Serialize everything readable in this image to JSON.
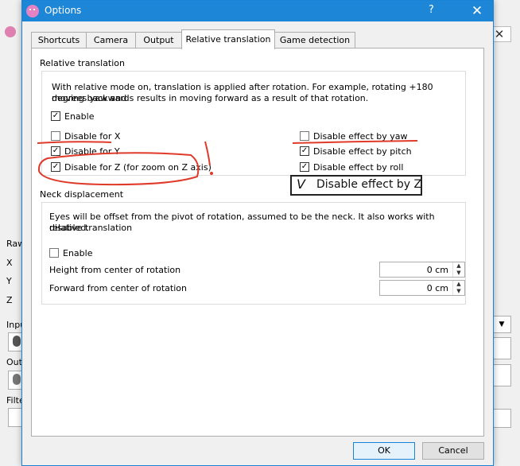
{
  "dialog": {
    "title": "Options",
    "help_label": "?",
    "close_label": "✕"
  },
  "tabs": [
    {
      "label": "Shortcuts"
    },
    {
      "label": "Camera"
    },
    {
      "label": "Output"
    },
    {
      "label": "Relative translation",
      "active": true
    },
    {
      "label": "Game detection"
    }
  ],
  "relative_translation": {
    "section_title": "Relative translation",
    "description_line1": "With relative mode on, translation is applied after rotation. For example, rotating +180 degrees yaw and",
    "description_line2": "moving backwards results in moving forward as a result of that rotation.",
    "enable": {
      "label": "Enable",
      "checked": true
    },
    "disable_x": {
      "label": "Disable for X",
      "checked": false
    },
    "disable_y": {
      "label": "Disable for Y",
      "checked": true
    },
    "disable_z": {
      "label": "Disable for Z (for zoom on Z axis)",
      "checked": true
    },
    "disable_yaw": {
      "label": "Disable effect by yaw",
      "checked": false
    },
    "disable_pitch": {
      "label": "Disable effect by pitch",
      "checked": true
    },
    "disable_roll": {
      "label": "Disable effect by roll",
      "checked": true
    }
  },
  "neck_displacement": {
    "section_title": "Neck displacement",
    "description_line1": "Eyes will be offset from the pivot of rotation, assumed to be the neck. It also works with relative translation",
    "description_line2": "disabled.",
    "enable": {
      "label": "Enable",
      "checked": false
    },
    "height": {
      "label": "Height from center of rotation",
      "value": "0 cm"
    },
    "forward": {
      "label": "Forward from center of rotation",
      "value": "0 cm"
    }
  },
  "buttons": {
    "ok": "OK",
    "cancel": "Cancel"
  },
  "annotation": {
    "text": "Disable effect by Z",
    "mark": "V",
    "exclaim": "!"
  },
  "background": {
    "raw_label": "Raw",
    "x_label": "X",
    "y_label": "Y",
    "z_label": "Z",
    "input_label": "Inpu",
    "output_label": "Out",
    "filter_label": "Filte",
    "close_icon": "✕"
  },
  "colors": {
    "titlebar": "#1e86d6",
    "accent_border": "#1883d7",
    "annotation_red": "#e03a2a"
  }
}
